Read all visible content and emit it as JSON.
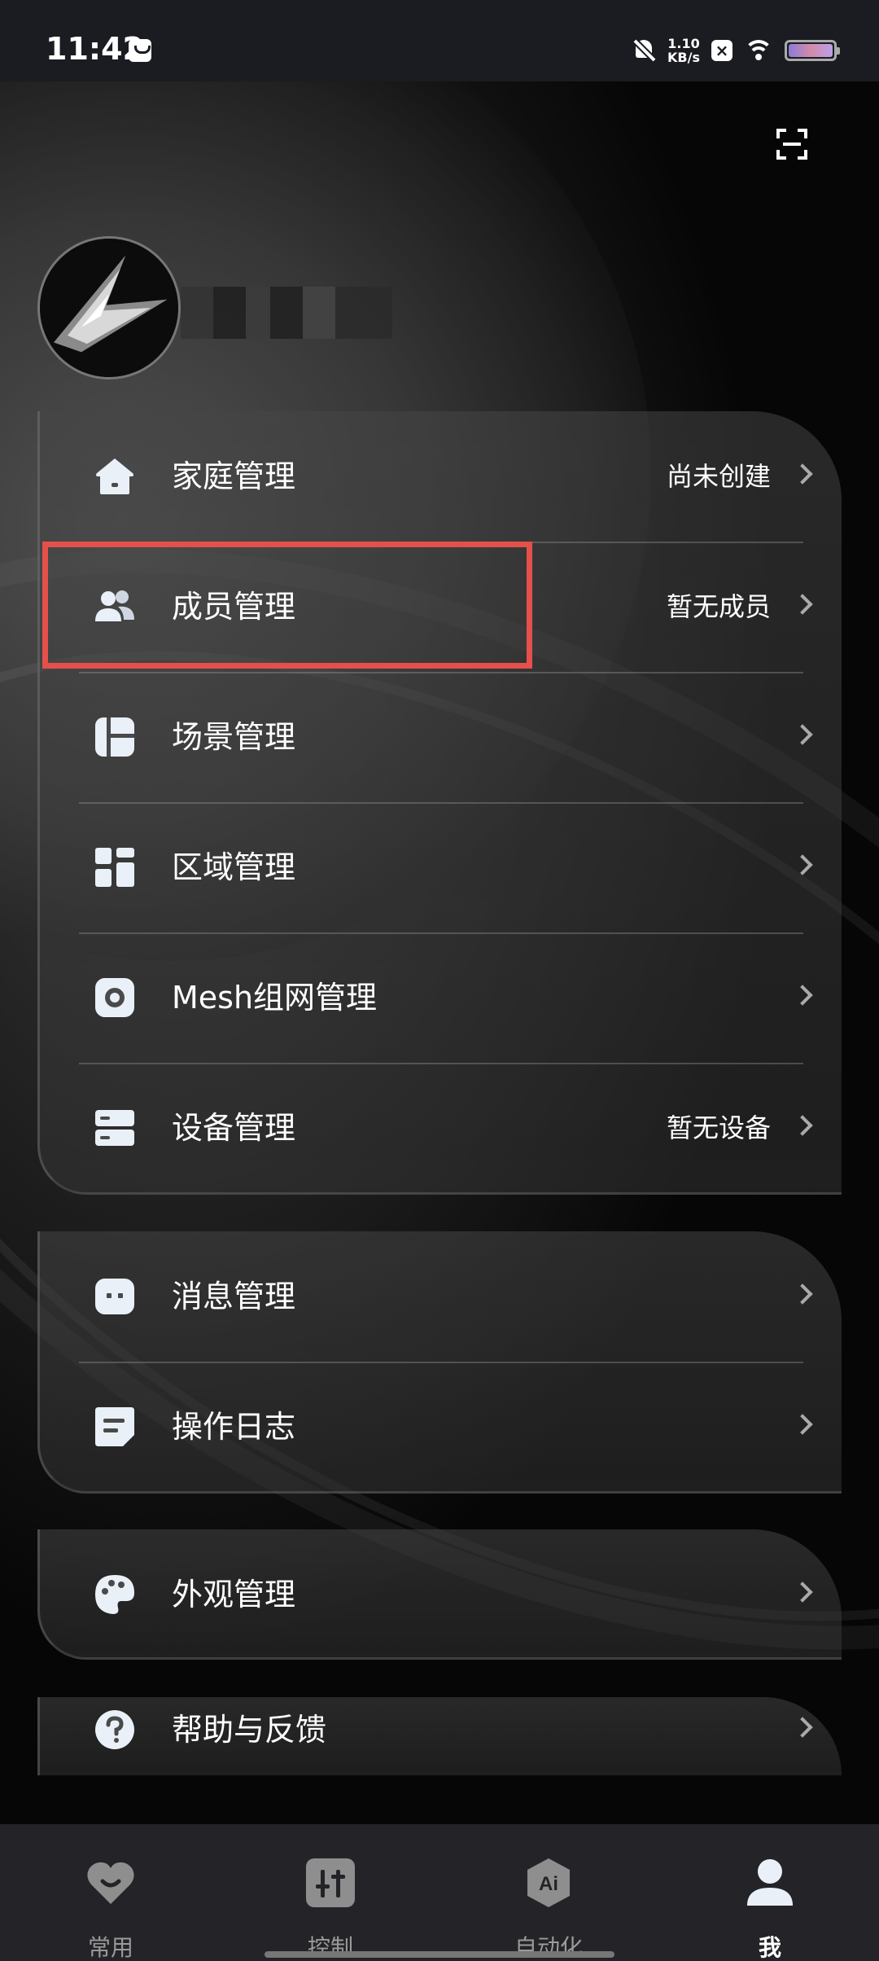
{
  "status_bar": {
    "time": "11:42",
    "net_speed_value": "1.10",
    "net_speed_unit": "KB/s",
    "badge_x": "×"
  },
  "menu_group_1": [
    {
      "label": "家庭管理",
      "value": "尚未创建",
      "icon": "home-icon"
    },
    {
      "label": "成员管理",
      "value": "暂无成员",
      "icon": "members-icon"
    },
    {
      "label": "场景管理",
      "value": "",
      "icon": "scene-icon"
    },
    {
      "label": "区域管理",
      "value": "",
      "icon": "area-icon"
    },
    {
      "label": "Mesh组网管理",
      "value": "",
      "icon": "mesh-icon"
    },
    {
      "label": "设备管理",
      "value": "暂无设备",
      "icon": "device-icon"
    }
  ],
  "menu_group_2": [
    {
      "label": "消息管理",
      "icon": "message-icon"
    },
    {
      "label": "操作日志",
      "icon": "log-icon"
    }
  ],
  "menu_group_3": [
    {
      "label": "外观管理",
      "icon": "palette-icon"
    }
  ],
  "menu_group_4": [
    {
      "label": "帮助与反馈",
      "icon": "help-icon"
    }
  ],
  "tabs": [
    {
      "label": "常用",
      "icon": "heart-icon",
      "active": false
    },
    {
      "label": "控制",
      "icon": "sliders-icon",
      "active": false
    },
    {
      "label": "自动化",
      "icon": "ai-icon",
      "icon_text": "Ai",
      "active": false
    },
    {
      "label": "我",
      "icon": "person-icon",
      "active": true
    }
  ],
  "colors": {
    "highlight": "#e5504b",
    "tab_active": "#ffffff",
    "tab_inactive": "#9a9a9a"
  }
}
